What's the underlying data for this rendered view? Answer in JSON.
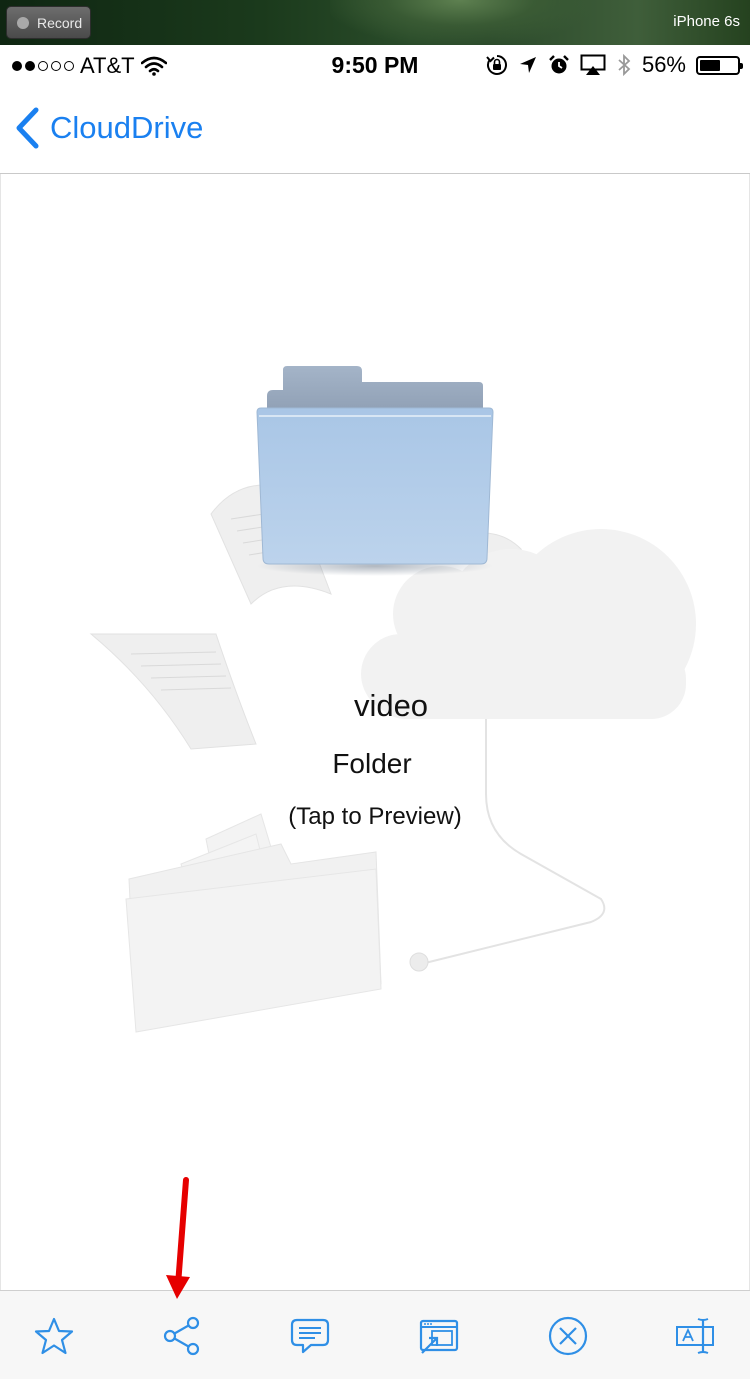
{
  "simulator": {
    "record_label": "Record",
    "device_name": "iPhone 6s"
  },
  "status_bar": {
    "carrier": "AT&T",
    "signal_dots_on": 2,
    "signal_dots_total": 5,
    "time": "9:50 PM",
    "battery_percent": "56%",
    "battery_level": 0.56,
    "icons": [
      "wifi-icon",
      "rotation-lock-icon",
      "location-icon",
      "alarm-icon",
      "airplay-icon",
      "bluetooth-icon",
      "battery-icon"
    ]
  },
  "nav": {
    "back_label": "CloudDrive",
    "accent_color": "#1a80f0"
  },
  "item": {
    "name": "video",
    "kind": "Folder",
    "hint": "(Tap to Preview)"
  },
  "toolbar": {
    "items": [
      "star-icon",
      "share-icon",
      "comment-icon",
      "open-in-icon",
      "close-circle-icon",
      "rename-icon"
    ],
    "icon_color": "#2f8fe6"
  },
  "annotation": {
    "arrow_color": "#e60000",
    "points_to": "share-icon"
  }
}
